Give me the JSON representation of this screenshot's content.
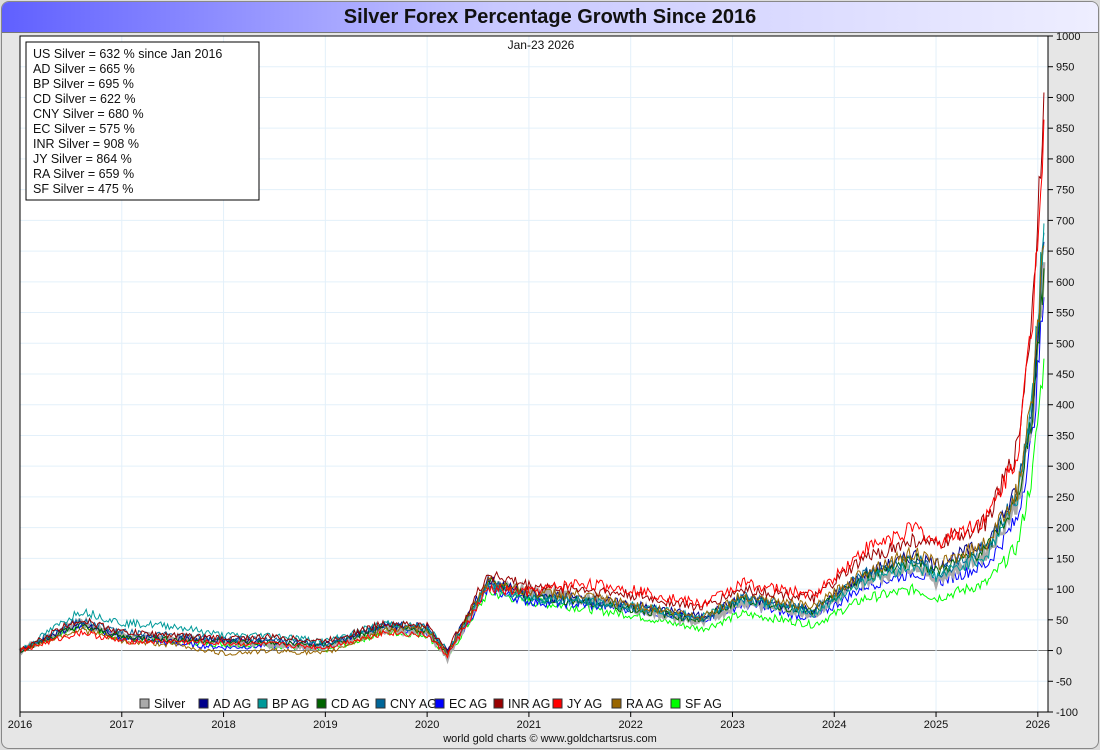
{
  "chart_data": {
    "type": "line",
    "title": "Silver Forex Percentage Growth Since 2016",
    "date_label": "Jan-23  2026",
    "footer": "world gold charts © www.goldchartsrus.com",
    "xlim": [
      2016,
      2026.1
    ],
    "ylim": [
      -100,
      1000
    ],
    "x_ticks": [
      "2016",
      "2017",
      "2018",
      "2019",
      "2020",
      "2021",
      "2022",
      "2023",
      "2024",
      "2025",
      "2026"
    ],
    "y_ticks": [
      -100,
      -50,
      0,
      50,
      100,
      150,
      200,
      250,
      300,
      350,
      400,
      450,
      500,
      550,
      600,
      650,
      700,
      750,
      800,
      850,
      900,
      950,
      1000
    ],
    "grid": true,
    "info_box": [
      "US Silver = 632 % since Jan 2016",
      "AD Silver = 665 %",
      "BP Silver = 695 %",
      "CD Silver = 622 %",
      "CNY Silver = 680 %",
      "EC Silver = 575 %",
      "INR Silver = 908 %",
      "JY Silver = 864 %",
      "RA Silver = 659 %",
      "SF Silver = 475 %"
    ],
    "legend_position": "bottom",
    "x": [
      2016,
      2016.5,
      2016.6,
      2017,
      2017.5,
      2018,
      2018.5,
      2019,
      2019.6,
      2020,
      2020.2,
      2020.6,
      2021,
      2021.5,
      2022,
      2022.7,
      2023.1,
      2023.8,
      2024.3,
      2024.8,
      2025.0,
      2025.5,
      2025.8,
      2025.95,
      2026.06
    ],
    "series": [
      {
        "name": "Silver",
        "color": "#aaaaaa",
        "values": [
          0,
          40,
          45,
          25,
          20,
          15,
          10,
          5,
          35,
          30,
          -10,
          110,
          95,
          85,
          70,
          45,
          80,
          60,
          115,
          140,
          115,
          160,
          240,
          380,
          632
        ]
      },
      {
        "name": "AD AG",
        "color": "#00008b",
        "values": [
          0,
          38,
          42,
          22,
          18,
          18,
          15,
          10,
          40,
          40,
          0,
          115,
          90,
          85,
          75,
          55,
          85,
          65,
          125,
          155,
          140,
          175,
          260,
          400,
          665
        ]
      },
      {
        "name": "BP AG",
        "color": "#009999",
        "values": [
          0,
          55,
          65,
          45,
          40,
          25,
          25,
          15,
          45,
          38,
          0,
          105,
          85,
          80,
          72,
          55,
          85,
          60,
          115,
          140,
          120,
          155,
          250,
          420,
          695
        ]
      },
      {
        "name": "CD AG",
        "color": "#006400",
        "values": [
          0,
          35,
          40,
          22,
          18,
          15,
          12,
          8,
          37,
          32,
          -5,
          112,
          88,
          80,
          68,
          50,
          85,
          62,
          120,
          150,
          128,
          165,
          245,
          390,
          622
        ]
      },
      {
        "name": "CNY AG",
        "color": "#006699",
        "values": [
          0,
          45,
          50,
          30,
          25,
          18,
          18,
          10,
          42,
          35,
          -5,
          110,
          88,
          80,
          70,
          50,
          88,
          65,
          125,
          150,
          125,
          168,
          255,
          410,
          680
        ]
      },
      {
        "name": "EC AG",
        "color": "#0000ff",
        "values": [
          0,
          38,
          42,
          20,
          12,
          5,
          8,
          5,
          38,
          30,
          -8,
          100,
          80,
          75,
          68,
          50,
          75,
          52,
          105,
          128,
          110,
          140,
          215,
          350,
          575
        ]
      },
      {
        "name": "INR AG",
        "color": "#990000",
        "values": [
          0,
          45,
          50,
          30,
          25,
          20,
          22,
          15,
          45,
          40,
          0,
          125,
          105,
          100,
          90,
          70,
          100,
          85,
          150,
          180,
          170,
          210,
          330,
          560,
          908
        ]
      },
      {
        "name": "JY AG",
        "color": "#ff0000",
        "values": [
          0,
          25,
          30,
          15,
          15,
          12,
          10,
          5,
          30,
          25,
          -8,
          100,
          95,
          110,
          100,
          75,
          110,
          90,
          165,
          200,
          175,
          215,
          320,
          540,
          864
        ]
      },
      {
        "name": "RA AG",
        "color": "#996600",
        "values": [
          0,
          30,
          35,
          15,
          10,
          -5,
          0,
          -5,
          35,
          35,
          -5,
          115,
          95,
          90,
          75,
          55,
          90,
          70,
          130,
          160,
          140,
          175,
          260,
          410,
          659
        ]
      },
      {
        "name": "SF AG",
        "color": "#00ff00",
        "values": [
          0,
          35,
          40,
          20,
          15,
          10,
          8,
          0,
          30,
          25,
          -12,
          95,
          80,
          70,
          58,
          35,
          60,
          42,
          85,
          100,
          85,
          110,
          170,
          290,
          475
        ]
      }
    ]
  }
}
